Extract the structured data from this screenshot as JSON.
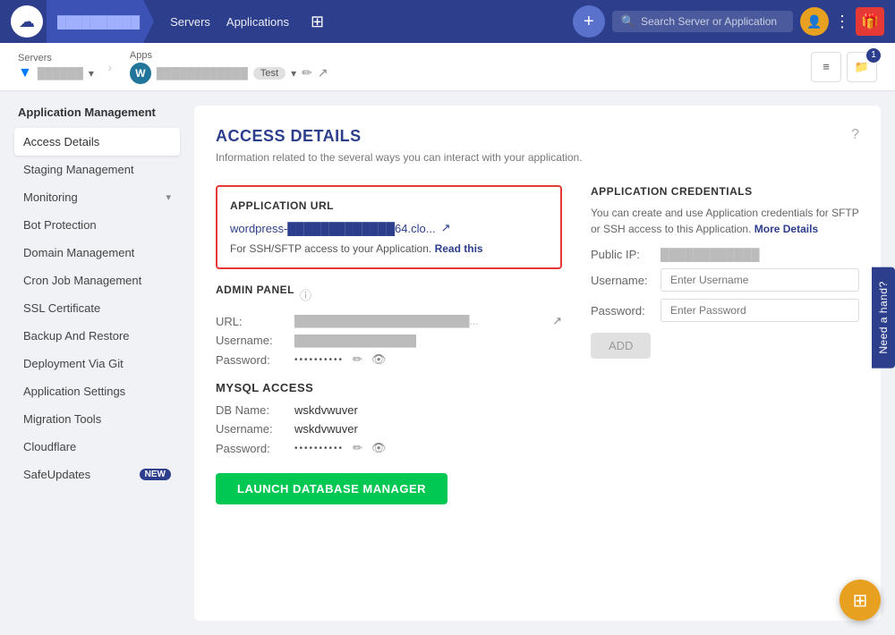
{
  "topnav": {
    "servers_label": "Servers",
    "applications_label": "Applications",
    "plus_icon": "+",
    "search_placeholder": "Search Server or Application",
    "server_name_blurred": "██████████"
  },
  "secondary_nav": {
    "servers_label": "Servers",
    "server_name": "██████",
    "apps_label": "Apps",
    "app_name_blurred": "████████████",
    "app_badge": "Test",
    "files_count": "1"
  },
  "sidebar": {
    "title": "Application Management",
    "items": [
      {
        "id": "access-details",
        "label": "Access Details",
        "active": true
      },
      {
        "id": "staging-management",
        "label": "Staging Management",
        "active": false
      },
      {
        "id": "monitoring",
        "label": "Monitoring",
        "active": false,
        "has_arrow": true
      },
      {
        "id": "bot-protection",
        "label": "Bot Protection",
        "active": false
      },
      {
        "id": "domain-management",
        "label": "Domain Management",
        "active": false
      },
      {
        "id": "cron-job-management",
        "label": "Cron Job Management",
        "active": false
      },
      {
        "id": "ssl-certificate",
        "label": "SSL Certificate",
        "active": false
      },
      {
        "id": "backup-and-restore",
        "label": "Backup And Restore",
        "active": false
      },
      {
        "id": "deployment-via-git",
        "label": "Deployment Via Git",
        "active": false
      },
      {
        "id": "application-settings",
        "label": "Application Settings",
        "active": false
      },
      {
        "id": "migration-tools",
        "label": "Migration Tools",
        "active": false
      },
      {
        "id": "cloudflare",
        "label": "Cloudflare",
        "active": false
      },
      {
        "id": "safeupdates",
        "label": "SafeUpdates",
        "active": false,
        "badge": "NEW"
      }
    ]
  },
  "content": {
    "title": "ACCESS DETAILS",
    "subtitle": "Information related to the several ways you can interact with your application.",
    "app_url_section": {
      "label": "APPLICATION URL",
      "url_text": "wordpress-█████████████64.clo...",
      "ssh_note": "For SSH/SFTP access to your Application.",
      "read_this_link": "Read this"
    },
    "admin_panel": {
      "label": "ADMIN PANEL",
      "url_label": "URL:",
      "url_value": "███████████████████████...",
      "username_label": "Username:",
      "username_value": "████████████████",
      "password_label": "Password:",
      "password_dots": "••••••••••"
    },
    "mysql_access": {
      "label": "MYSQL ACCESS",
      "db_name_label": "DB Name:",
      "db_name_value": "wskdvwuver",
      "username_label": "Username:",
      "username_value": "wskdvwuver",
      "password_label": "Password:",
      "password_dots": "••••••••••"
    },
    "launch_btn_label": "LAUNCH DATABASE MANAGER"
  },
  "credentials": {
    "title": "APPLICATION CREDENTIALS",
    "description": "You can create and use Application credentials for SFTP or SSH access to this Application.",
    "more_details_link": "More Details",
    "public_ip_label": "Public IP:",
    "public_ip_value": "████████████",
    "username_label": "Username:",
    "username_placeholder": "Enter Username",
    "password_label": "Password:",
    "password_placeholder": "Enter Password",
    "add_btn_label": "ADD"
  },
  "need_hand_label": "Need a hand?",
  "fab_icon": "⊞"
}
